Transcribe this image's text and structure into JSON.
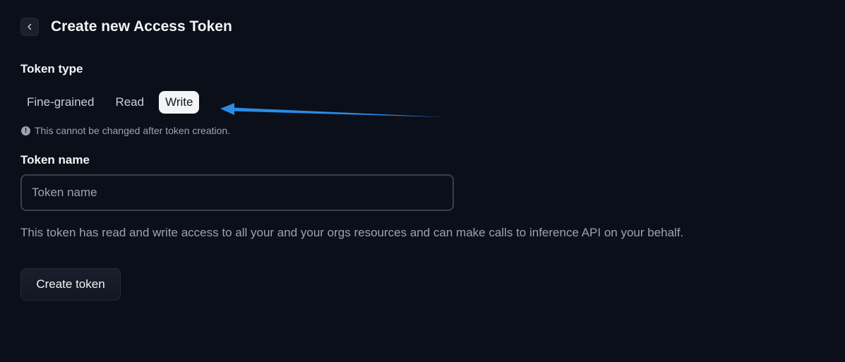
{
  "header": {
    "title": "Create new Access Token",
    "back_icon": "chevron-left-icon"
  },
  "token_type": {
    "label": "Token type",
    "options": [
      "Fine-grained",
      "Read",
      "Write"
    ],
    "selected": "Write",
    "warning": "This cannot be changed after token creation.",
    "warning_icon": "!"
  },
  "token_name": {
    "label": "Token name",
    "placeholder": "Token name",
    "value": ""
  },
  "description": "This token has read and write access to all your and your orgs resources and can make calls to inference API on your behalf.",
  "actions": {
    "create_label": "Create token"
  },
  "colors": {
    "background": "#0b0f19",
    "annotation_arrow": "#2b8ce6"
  }
}
